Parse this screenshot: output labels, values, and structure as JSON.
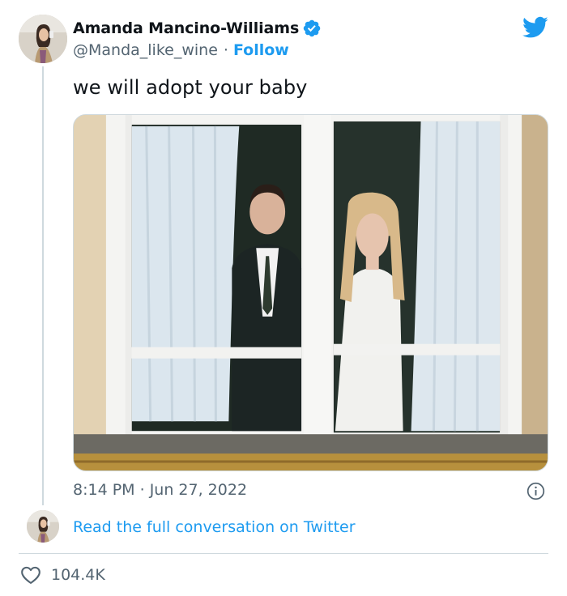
{
  "tweet": {
    "author_name": "Amanda Mancino-Williams",
    "author_handle": "@Manda_like_wine",
    "separator": "·",
    "follow_label": "Follow",
    "text": "we will adopt your baby",
    "time": "8:14 PM",
    "date": "Jun 27, 2022",
    "read_conversation_label": "Read the full conversation on Twitter",
    "likes": "104.4K"
  },
  "icons": {
    "verified": "verified-badge-icon",
    "logo": "twitter-bird-icon",
    "info": "info-icon",
    "like": "heart-icon"
  },
  "colors": {
    "accent": "#1d9bf0",
    "text_primary": "#0f1419",
    "text_secondary": "#536471",
    "border": "#cfd9de"
  }
}
